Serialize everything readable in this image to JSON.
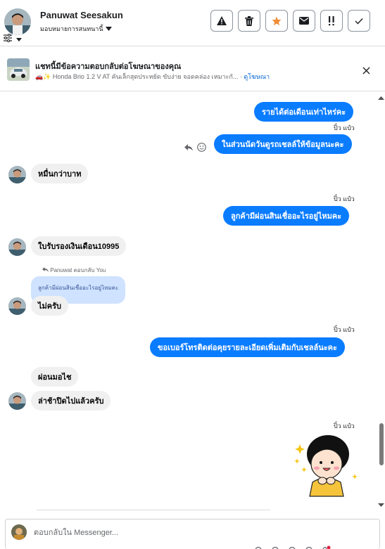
{
  "header": {
    "contact_name": "Panuwat Seesakun",
    "assign_label": "มอบหมายการสนทนานี้",
    "actions": [
      {
        "icon": "warning-icon",
        "name": "spam-button"
      },
      {
        "icon": "trash-icon",
        "name": "delete-button"
      },
      {
        "icon": "star-icon",
        "name": "star-button"
      },
      {
        "icon": "envelope-icon",
        "name": "mark-unread-button"
      },
      {
        "icon": "follow-up-icon",
        "name": "follow-up-button"
      },
      {
        "icon": "check-icon",
        "name": "done-button"
      }
    ]
  },
  "ad": {
    "title": "แชทนี้มีข้อความตอบกลับต่อโฆษณาของคุณ",
    "subtitle": "🚗✨ Honda Brio 1.2 V AT คันเล็กสุดประหยัด ขับง่าย จอดคล่อง เหมาะกั... · ",
    "link": "ดูโฆษณา"
  },
  "messages": {
    "m1": "รายได้ต่อเดือนเท่าไหร่คะ",
    "s1": "ปิ๋ว แป๋ว",
    "m2": "ในส่วนนัดวันดูรถเชลล์ให้ข้อมูลนะคะ",
    "m3": "หมื่นกว่าบาท",
    "s2": "ปิ๋ว แป๋ว",
    "m4": "ลูกค้ามีผ่อนสินเชื่ออะไรอยู่ไหมคะ",
    "m5": "ใบรับรองเงินเดือน10995",
    "reply_note": "Panuwat ตอบกลับ You",
    "reply_quote": "ลูกค้ามีผ่อนสินเชื่ออะไรอยู่ไหมคะ",
    "m6": "ไม่ครับ",
    "s3": "ปิ๋ว แป๋ว",
    "m7": "ขอเบอร์โทรติดต่อคุยรายละเอียดเพิ่มเติมกับเชลล์นะคะ",
    "m8": "ผ่อนมอไช",
    "m9": "ล่าช้าปิดไปแล้วครับ",
    "s4": "ปิ๋ว แป๋ว"
  },
  "composer": {
    "placeholder": "ตอบกลับใน Messenger..."
  },
  "colors": {
    "outgoing": "#0a7cff",
    "incoming": "#f0f0f0",
    "quote": "#cfe2ff",
    "star": "#f08c36"
  }
}
